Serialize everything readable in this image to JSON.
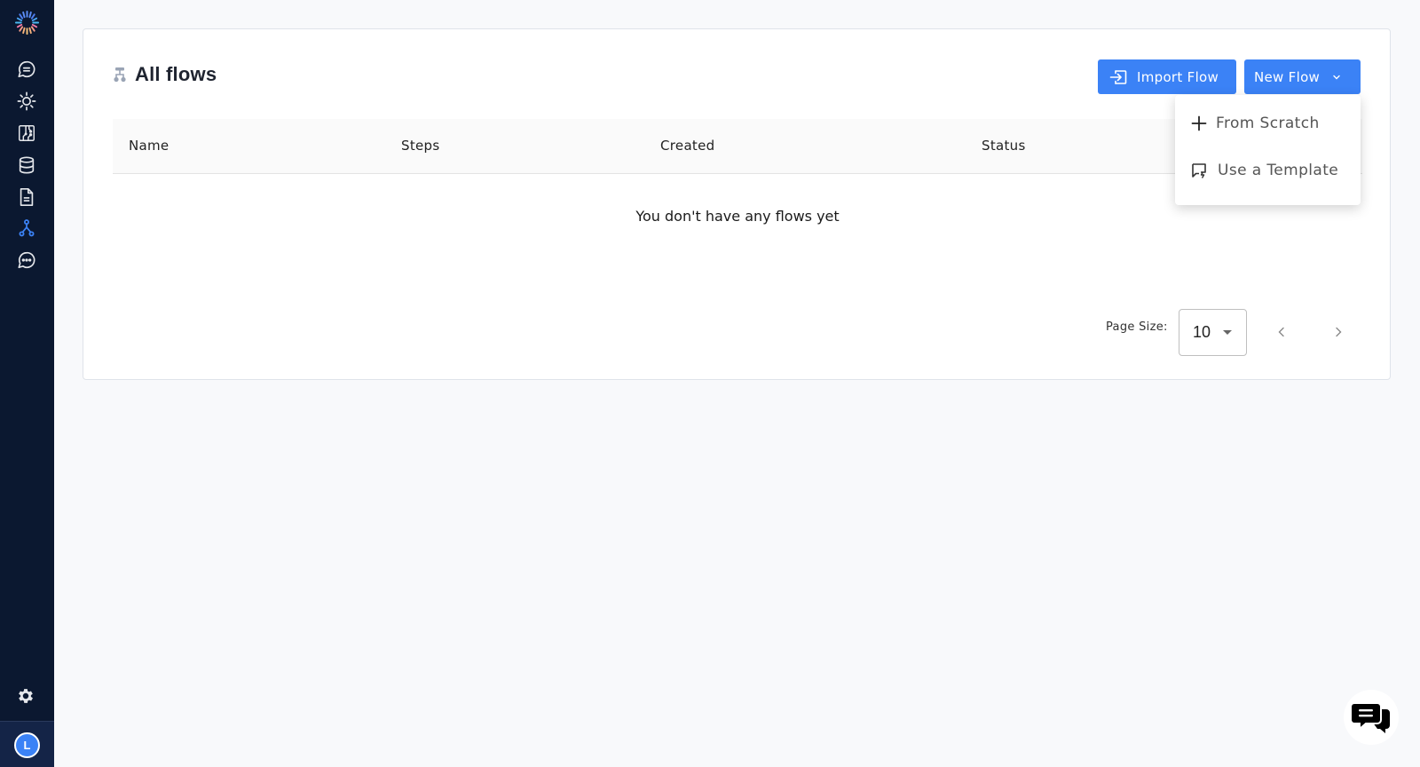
{
  "sidebar": {
    "logo": "brand-logo",
    "items": [
      {
        "icon": "chat-bubble-icon",
        "active": false
      },
      {
        "icon": "sun-icon",
        "active": false
      },
      {
        "icon": "circuit-board-icon",
        "active": false
      },
      {
        "icon": "database-icon",
        "active": false
      },
      {
        "icon": "document-icon",
        "active": false
      },
      {
        "icon": "flow-branch-icon",
        "active": true
      },
      {
        "icon": "chat-dots-icon",
        "active": false
      }
    ],
    "settings_icon": "gear-icon",
    "avatar_initial": "L",
    "colors": {
      "background": "#0b1830",
      "active": "#3b82f6",
      "icon": "#e5e7eb"
    }
  },
  "header": {
    "title": "All flows",
    "title_icon": "flow-tree-icon",
    "import_button": "Import Flow",
    "new_button": "New Flow",
    "accent_color": "#3b82f6"
  },
  "new_flow_menu": {
    "items": [
      {
        "label": "From Scratch",
        "icon": "plus-icon"
      },
      {
        "label": "Use a Template",
        "icon": "template-icon"
      }
    ]
  },
  "table": {
    "columns": [
      "Name",
      "Steps",
      "Created",
      "Status"
    ],
    "rows": [],
    "empty_message": "You don't have any flows yet"
  },
  "pagination": {
    "page_size_label": "Page Size:",
    "page_size": "10"
  },
  "chat_widget": {
    "icon": "support-chat-icon"
  }
}
